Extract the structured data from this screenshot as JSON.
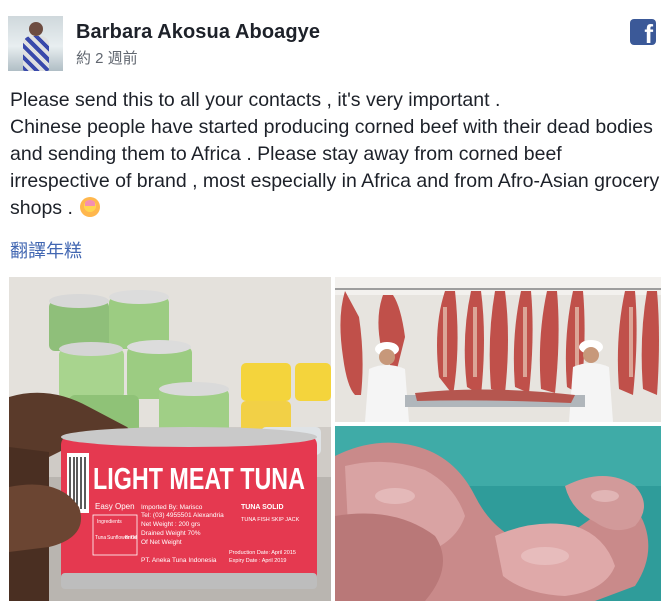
{
  "post": {
    "author": "Barbara Akosua Aboagye",
    "timestamp": "約 2 週前",
    "platform_icon": "facebook-icon",
    "body_lines": [
      "Please send this to all your contacts , it's very important .",
      "Chinese people have started producing corned beef with their dead bodies and sending them to Africa . Please stay away from corned beef irrespective of brand , most especially in Africa and from Afro-Asian grocery shops ."
    ],
    "translate_link": "翻譯年糕"
  },
  "photos": {
    "can_label": {
      "title": "LIGHT MEAT TUNA",
      "easy_open": "Easy Open",
      "imported_by": "Imported By: Marisco",
      "phone": "Tel: (03) 4955501 Alexandria",
      "net_weight": "Net Weight : 200 grs",
      "drained_weight": "Drained Weight 70%",
      "of_net_weight": "Of Net Weight",
      "producer": "PT. Aneka Tuna Indonesia",
      "tuna_solid": "TUNA SOLID",
      "tuna_fish": "TUNA FISH SKIP JACK",
      "production_date": "Production Date: April 2015",
      "expiry_date": "Expiry Date : April 2019",
      "ingredients": "Ingredients",
      "ingredient_items": [
        "Tuna",
        "Sunflower Oil",
        "Brine"
      ]
    }
  },
  "colors": {
    "link": "#4267b2",
    "facebook_blue": "#3b5998",
    "can_red": "#e53950"
  }
}
